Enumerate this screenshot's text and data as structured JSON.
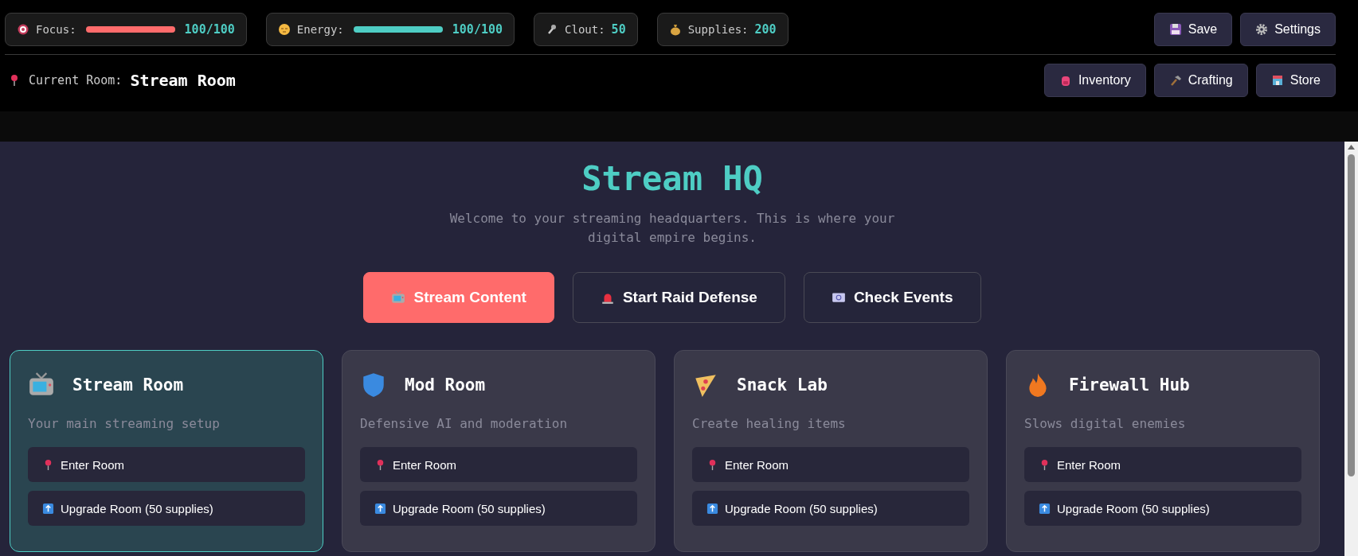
{
  "stats": [
    {
      "label": "Focus:",
      "level": 1,
      "reading": "100/100",
      "color": "#ff6b6b"
    },
    {
      "label": "Energy:",
      "level": 1,
      "reading": "100/100",
      "color": "#4ecdc4"
    },
    {
      "label": "Clout:",
      "reading": "50"
    },
    {
      "label": "Supplies:",
      "reading": "200"
    }
  ],
  "top_buttons": [
    "Save",
    "Settings"
  ],
  "current_room": {
    "label": "Current Room:",
    "value": "Stream Room"
  },
  "nav_buttons": [
    "Inventory",
    "Crafting",
    "Store"
  ],
  "title": "Stream HQ",
  "subtitle": "Welcome to your streaming headquarters. This is where your digital empire begins.",
  "actions": [
    {
      "label": "Stream Content",
      "kind": "primary"
    },
    {
      "label": "Start Raid Defense",
      "kind": "outline"
    },
    {
      "label": "Check Events",
      "kind": "outline"
    }
  ],
  "rooms": [
    {
      "name": "Stream Room",
      "description": "Your main streaming setup",
      "selected": true,
      "buttons": [
        "Enter Room",
        "Upgrade Room (50 supplies)"
      ]
    },
    {
      "name": "Mod Room",
      "description": "Defensive AI and moderation",
      "selected": false,
      "buttons": [
        "Enter Room",
        "Upgrade Room (50 supplies)"
      ]
    },
    {
      "name": "Snack Lab",
      "description": "Create healing items",
      "selected": false,
      "buttons": [
        "Enter Room",
        "Upgrade Room (50 supplies)"
      ]
    },
    {
      "name": "Firewall Hub",
      "description": "Slows digital enemies",
      "selected": false,
      "buttons": [
        "Enter Room",
        "Upgrade Room (50 supplies)"
      ]
    }
  ]
}
